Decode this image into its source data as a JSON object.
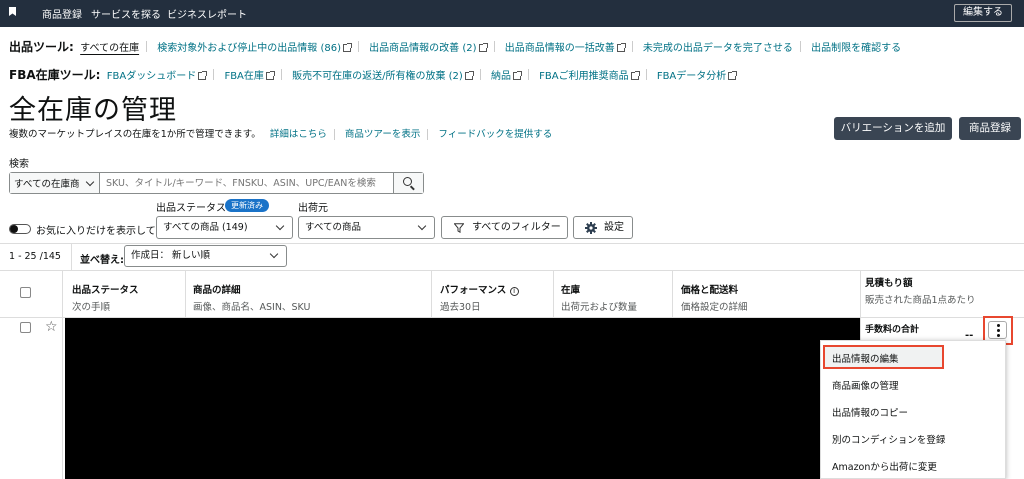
{
  "topnav": {
    "items": [
      "商品登録",
      "サービスを探る",
      "ビジネスレポート"
    ],
    "edit_label": "編集する"
  },
  "listing_tools": {
    "label": "出品ツール:",
    "links": [
      "すべての在庫",
      "検索対象外および停止中の出品情報 (86)",
      "出品商品情報の改善 (2)",
      "出品商品情報の一括改善",
      "未完成の出品データを完了させる",
      "出品制限を確認する"
    ]
  },
  "fba_tools": {
    "label": "FBA在庫ツール:",
    "links": [
      "FBAダッシュボード",
      "FBA在庫",
      "販売不可在庫の返送/所有権の放棄 (2)",
      "納品",
      "FBAご利用推奨商品",
      "FBAデータ分析"
    ]
  },
  "page": {
    "title": "全在庫の管理",
    "subtitle": "複数のマーケットプレイスの在庫を1か所で管理できます。",
    "links": [
      "詳細はこちら",
      "商品ツアーを表示",
      "フィードバックを提供する"
    ],
    "add_variation": "バリエーションを追加",
    "add_product": "商品登録"
  },
  "search": {
    "label": "検索",
    "scope": "すべての在庫商",
    "placeholder": "SKU、タイトル/キーワード、FNSKU、ASIN、UPC/EANを検索"
  },
  "filters": {
    "favorites_label": "お気に入りだけを表示して",
    "status_label": "出品ステータス",
    "status_badge": "更新済み",
    "status_value": "すべての商品 (149)",
    "ship_label": "出荷元",
    "ship_value": "すべての商品",
    "all_filters": "すべてのフィルター",
    "settings": "設定"
  },
  "listing": {
    "count": "1 - 25 /145",
    "sort_label": "並べ替え:",
    "sort_value": "作成日： 新しい順"
  },
  "columns": [
    {
      "title": "出品ステータス",
      "sub": "次の手順"
    },
    {
      "title": "商品の詳細",
      "sub": "画像、商品名、ASIN、SKU"
    },
    {
      "title": "パフォーマンス",
      "sub": "過去30日"
    },
    {
      "title": "在庫",
      "sub": "出荷元および数量"
    },
    {
      "title": "価格と配送料",
      "sub": "価格設定の詳細"
    },
    {
      "title": "見積もり額",
      "sub": "販売された商品1点あたり"
    }
  ],
  "row": {
    "fee_label": "手数料の合計",
    "dash": "--"
  },
  "menu": {
    "items": [
      "出品情報の編集",
      "商品画像の管理",
      "出品情報のコピー",
      "別のコンディションを登録",
      "Amazonから出荷に変更"
    ]
  },
  "colors": {
    "nav_bg": "#232f3e",
    "link": "#007185",
    "highlight": "#e8472f",
    "badge": "#1a73c8",
    "dark_button": "#3a4553"
  }
}
